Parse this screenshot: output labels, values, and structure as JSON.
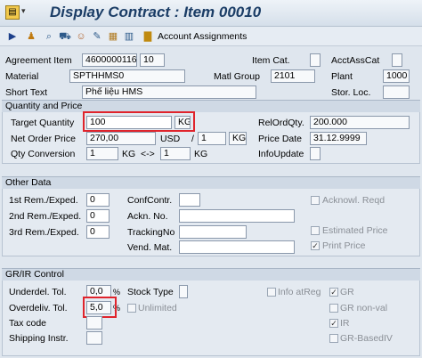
{
  "window": {
    "title": "Display Contract : Item 00010"
  },
  "toolbar": {
    "account_assignments_label": "Account Assignments"
  },
  "header": {
    "agreement_item_label": "Agreement Item",
    "agreement_value": "4600000116",
    "item_value": "10",
    "item_cat_label": "Item Cat.",
    "item_cat_value": "",
    "acctasscat_label": "AcctAssCat",
    "acctasscat_value": "",
    "material_label": "Material",
    "material_value": "SPTHHMS0",
    "matl_group_label": "Matl Group",
    "matl_group_value": "2101",
    "plant_label": "Plant",
    "plant_value": "1000",
    "short_text_label": "Short Text",
    "short_text_value": "Phế liệu HMS",
    "stor_loc_label": "Stor. Loc.",
    "stor_loc_value": ""
  },
  "qty_price": {
    "section_title": "Quantity and Price",
    "target_qty_label": "Target Quantity",
    "target_qty_value": "100",
    "target_qty_unit": "KG",
    "relordqty_label": "RelOrdQty.",
    "relordqty_value": "200.000",
    "net_price_label": "Net Order Price",
    "net_price_value": "270,00",
    "currency": "USD",
    "per_sep": "/",
    "per_value": "1",
    "per_unit": "KG",
    "price_date_label": "Price Date",
    "price_date_value": "31.12.9999",
    "qty_conv_label": "Qty Conversion",
    "conv_left_value": "1",
    "conv_left_unit": "KG",
    "conv_arrow": "<->",
    "conv_right_value": "1",
    "conv_right_unit": "KG",
    "info_update_label": "InfoUpdate",
    "info_update_value": ""
  },
  "other_data": {
    "section_title": "Other Data",
    "rem1_label": "1st Rem./Exped.",
    "rem1_value": "0",
    "rem2_label": "2nd Rem./Exped.",
    "rem2_value": "0",
    "rem3_label": "3rd Rem./Exped.",
    "rem3_value": "0",
    "confcontr_label": "ConfContr.",
    "ackn_no_label": "Ackn. No.",
    "tracking_label": "TrackingNo",
    "vend_mat_label": "Vend. Mat.",
    "ackn_reqd_label": "Acknowl. Reqd",
    "ackn_reqd_checked": false,
    "est_price_label": "Estimated Price",
    "est_price_checked": false,
    "print_price_label": "Print Price",
    "print_price_checked": true
  },
  "grir": {
    "section_title": "GR/IR Control",
    "underdel_label": "Underdel. Tol.",
    "underdel_value": "0,0",
    "overdeliv_label": "Overdeliv. Tol.",
    "overdeliv_value": "5,0",
    "percent": "%",
    "tax_code_label": "Tax code",
    "shipping_label": "Shipping Instr.",
    "stock_type_label": "Stock Type",
    "unlimited_label": "Unlimited",
    "unlimited_checked": false,
    "info_at_reg_label": "Info atReg",
    "info_at_reg_checked": false,
    "gr_label": "GR",
    "gr_checked": true,
    "gr_nonval_label": "GR non-val",
    "gr_nonval_checked": false,
    "ir_label": "IR",
    "ir_checked": true,
    "gr_basediv_label": "GR-BasedIV",
    "gr_basediv_checked": false
  },
  "colors": {
    "highlight": "#e0242c",
    "title": "#1b3d66"
  }
}
